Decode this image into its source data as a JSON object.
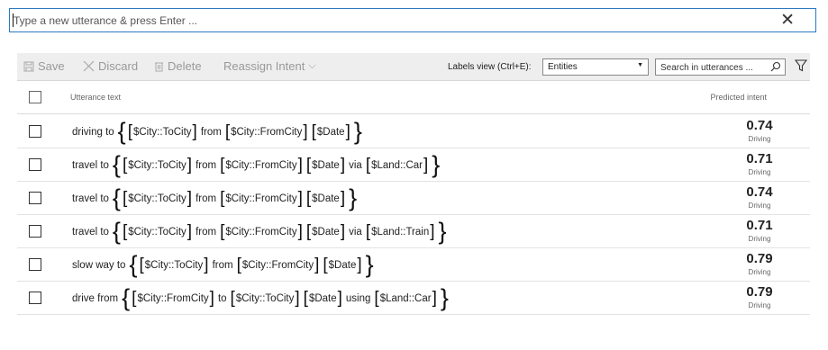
{
  "utterance_box": {
    "placeholder": "Type a new utterance & press Enter ...",
    "close_symbol": "✕"
  },
  "toolbar": {
    "save": "Save",
    "discard": "Discard",
    "delete": "Delete",
    "reassign": "Reassign Intent",
    "reassign_chevron": "⌵",
    "labels_view_label": "Labels view (Ctrl+E):",
    "labels_view_value": "Entities",
    "labels_view_arrow": "▼",
    "search_placeholder": "Search in utterances ..."
  },
  "icons": {
    "save": "save-icon",
    "discard": "close-icon",
    "delete": "trash-icon",
    "search": "search-icon",
    "filter": "filter-icon"
  },
  "table": {
    "header_utterance": "Utterance text",
    "header_intent": "Predicted intent",
    "rows": [
      {
        "prefix": "driving to",
        "parts": [
          {
            "entity": "$City::ToCity",
            "after": "from"
          },
          {
            "entity": "$City::FromCity",
            "after": ""
          },
          {
            "entity": "$Date",
            "after": ""
          }
        ],
        "score": "0.74",
        "intent": "Driving"
      },
      {
        "prefix": "travel to",
        "parts": [
          {
            "entity": "$City::ToCity",
            "after": "from"
          },
          {
            "entity": "$City::FromCity",
            "after": ""
          },
          {
            "entity": "$Date",
            "after": "via"
          },
          {
            "entity": "$Land::Car",
            "after": ""
          }
        ],
        "score": "0.71",
        "intent": "Driving"
      },
      {
        "prefix": "travel to",
        "parts": [
          {
            "entity": "$City::ToCity",
            "after": "from"
          },
          {
            "entity": "$City::FromCity",
            "after": ""
          },
          {
            "entity": "$Date",
            "after": ""
          }
        ],
        "score": "0.74",
        "intent": "Driving"
      },
      {
        "prefix": "travel to",
        "parts": [
          {
            "entity": "$City::ToCity",
            "after": "from"
          },
          {
            "entity": "$City::FromCity",
            "after": ""
          },
          {
            "entity": "$Date",
            "after": "via"
          },
          {
            "entity": "$Land::Train",
            "after": ""
          }
        ],
        "score": "0.71",
        "intent": "Driving"
      },
      {
        "prefix": "slow way to",
        "parts": [
          {
            "entity": "$City::ToCity",
            "after": "from"
          },
          {
            "entity": "$City::FromCity",
            "after": ""
          },
          {
            "entity": "$Date ",
            "after": ""
          }
        ],
        "score": "0.79",
        "intent": "Driving"
      },
      {
        "prefix": "drive from",
        "parts": [
          {
            "entity": "$City::FromCity",
            "after": "to"
          },
          {
            "entity": "$City::ToCity",
            "after": ""
          },
          {
            "entity": "$Date",
            "after": "using"
          },
          {
            "entity": "$Land::Car ",
            "after": ""
          }
        ],
        "score": "0.79",
        "intent": "Driving"
      }
    ]
  },
  "colors": {
    "accent": "#2b79c2",
    "toolbar_bg": "#eeeeee",
    "disabled_text": "#999999"
  }
}
